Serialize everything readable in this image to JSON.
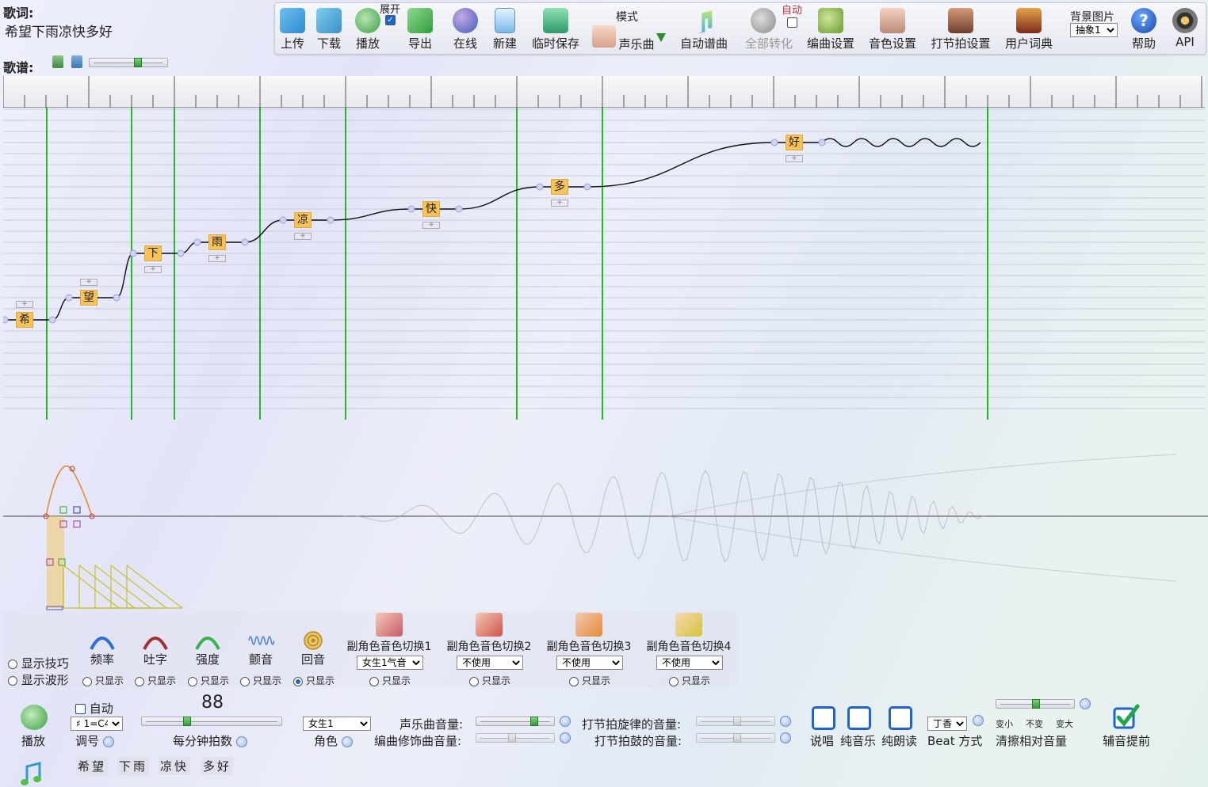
{
  "header": {
    "lyrics_label": "歌词:",
    "lyrics_text": "希望下雨凉快多好",
    "score_label": "歌谱:"
  },
  "toolbar": {
    "upload": "上传",
    "download": "下载",
    "play": "播放",
    "expand": "展开",
    "export": "导出",
    "online": "在线",
    "new": "新建",
    "temp_save": "临时保存",
    "mode_label": "模式",
    "mode_value": "声乐曲",
    "auto_compose": "自动谱曲",
    "auto_label": "自动",
    "convert_all": "全部转化",
    "arrange_settings": "编曲设置",
    "timbre_settings": "音色设置",
    "beat_settings": "打节拍设置",
    "user_dict": "用户词典",
    "bg_label": "背景图片",
    "bg_value": "抽象1",
    "help": "帮助",
    "api": "API"
  },
  "roll": {
    "syllables": [
      {
        "text": "希",
        "pitch": 0
      },
      {
        "text": "望",
        "pitch": 1
      },
      {
        "text": "下",
        "pitch": 3
      },
      {
        "text": "雨",
        "pitch": 3.5
      },
      {
        "text": "凉",
        "pitch": 4.5
      },
      {
        "text": "快",
        "pitch": 5
      },
      {
        "text": "多",
        "pitch": 6
      },
      {
        "text": "好",
        "pitch": 8
      }
    ]
  },
  "effects": {
    "show_skills": "显示技巧",
    "show_wave": "显示波形",
    "only_show": "只显示",
    "frequency": "频率",
    "articulation": "吐字",
    "strength": "强度",
    "vibrato": "颤音",
    "echo": "回音",
    "sub_roles": [
      {
        "label": "副角色音色切换1",
        "value": "女生1气音"
      },
      {
        "label": "副角色音色切换2",
        "value": "不使用"
      },
      {
        "label": "副角色音色切换3",
        "value": "不使用"
      },
      {
        "label": "副角色音色切换4",
        "value": "不使用"
      }
    ]
  },
  "bottom": {
    "play": "播放",
    "auto": "自动",
    "key_value": "♯ 1=C4",
    "key_label": "调号",
    "bpm_value": "88",
    "bpm_label": "每分钟拍数",
    "role_value": "女生1",
    "role_label": "角色",
    "vocal_volume": "声乐曲音量:",
    "arrange_volume": "编曲修饰曲音量:",
    "beat_melody_volume": "打节拍旋律的音量:",
    "beat_drum_volume": "打节拍鼓的音量:",
    "speak": "说唱",
    "pure_music": "纯音乐",
    "recite": "纯朗读",
    "beat_style_value": "丁香",
    "beat_style_label": "Beat 方式",
    "vol_smaller": "变小",
    "vol_same": "不变",
    "vol_larger": "变大",
    "relative_volume": "清擦相对音量",
    "assist_advance": "辅音提前",
    "phrases": [
      "希望",
      "下雨",
      "凉快",
      "多好"
    ]
  },
  "colors": {
    "bar_line": "#22bb22",
    "syllable": "#f6c35a",
    "pitch_curve": "#111111",
    "accent_blue": "#1e64d1"
  }
}
